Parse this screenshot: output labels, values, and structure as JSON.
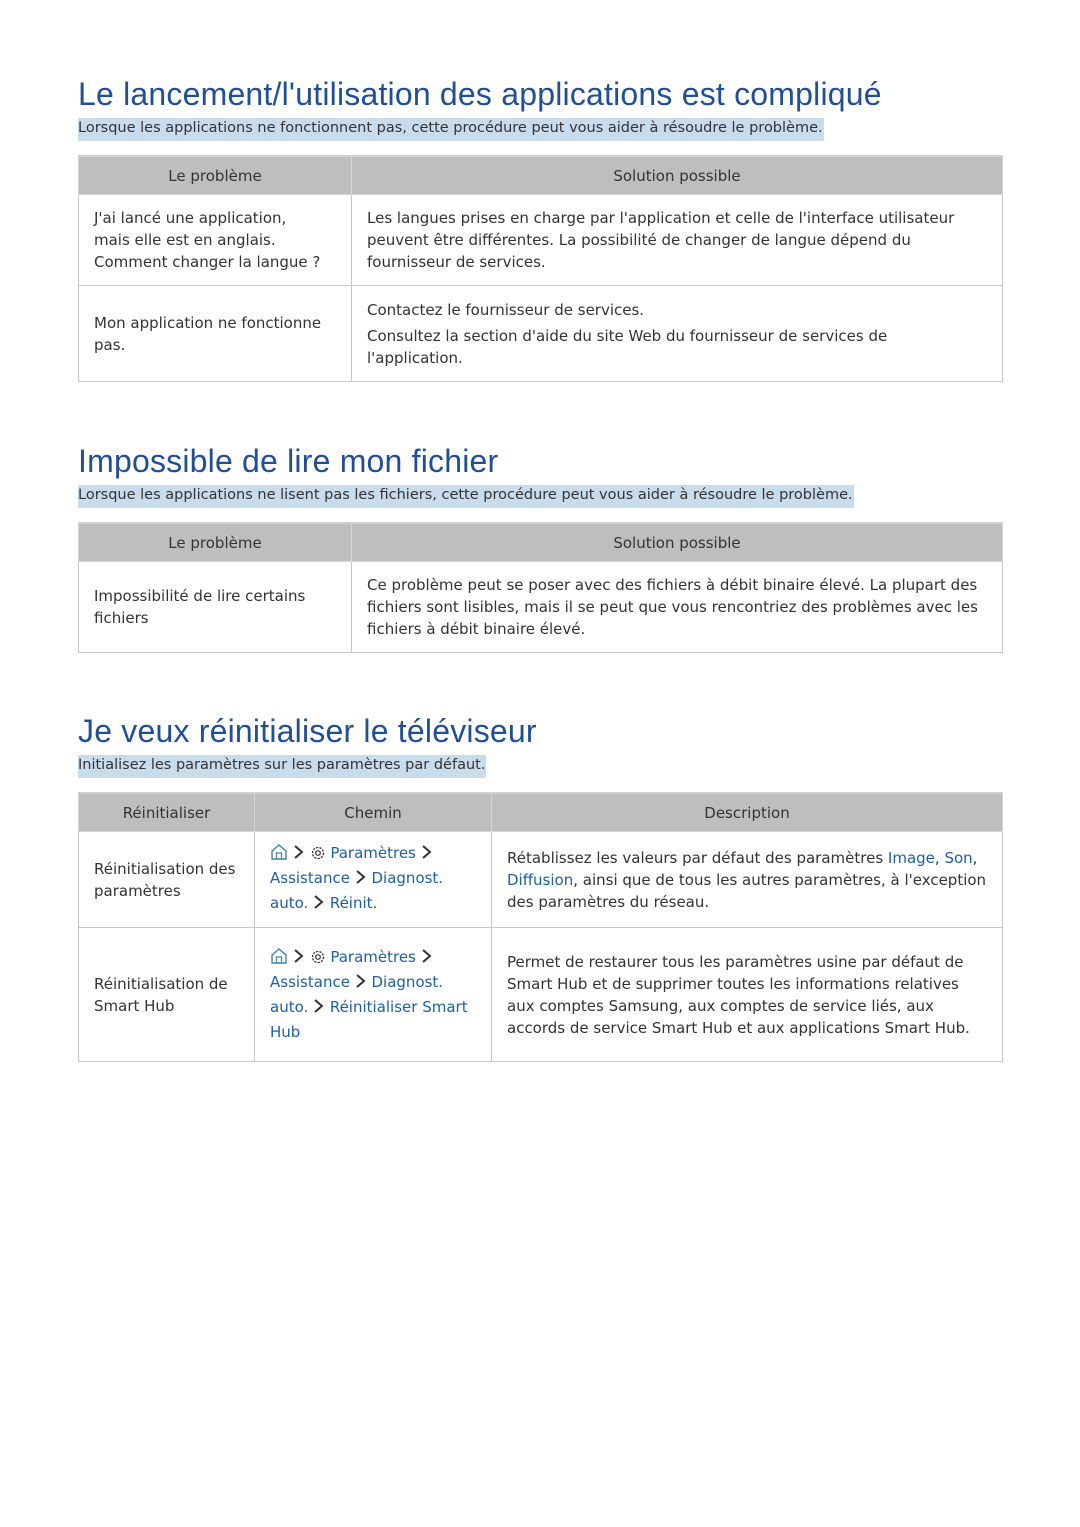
{
  "sections": [
    {
      "title": "Le lancement/l'utilisation des applications est compliqué",
      "intro": "Lorsque les applications ne fonctionnent pas, cette procédure peut vous aider à résoudre le problème.",
      "headers": [
        "Le problème",
        "Solution possible"
      ],
      "rows": [
        {
          "problem": [
            "J'ai lancé une application,",
            "mais elle est en anglais.",
            "Comment changer la langue ?"
          ],
          "solution": [
            "Les langues prises en charge par l'application et celle de l'interface utilisateur peuvent être différentes. La possibilité de changer de langue dépend du fournisseur de services."
          ]
        },
        {
          "problem": [
            "Mon application ne fonctionne pas."
          ],
          "solution": [
            "Contactez le fournisseur de services.",
            "Consultez la section d'aide du site Web du fournisseur de services de l'application."
          ]
        }
      ]
    },
    {
      "title": "Impossible de lire mon fichier",
      "intro": "Lorsque les applications ne lisent pas les fichiers, cette procédure peut vous aider à résoudre le problème.",
      "headers": [
        "Le problème",
        "Solution possible"
      ],
      "rows": [
        {
          "problem": [
            "Impossibilité de lire certains fichiers"
          ],
          "solution": [
            "Ce problème peut se poser avec des fichiers à débit binaire élevé. La plupart des fichiers sont lisibles, mais il se peut que vous rencontriez des problèmes avec les fichiers à débit binaire élevé."
          ]
        }
      ]
    },
    {
      "title": "Je veux réinitialiser le téléviseur",
      "intro": "Initialisez les paramètres sur les paramètres par défaut.",
      "headers": [
        "Réinitialiser",
        "Chemin",
        "Description"
      ],
      "rows": [
        {
          "reset": "Réinitialisation des paramètres",
          "path": {
            "home_icon": "home-icon",
            "settings_icon": "gear-icon",
            "settings": "Paramètres",
            "steps": [
              "Assistance",
              "Diagnost. auto.",
              "Réinit."
            ]
          },
          "description": {
            "before": "Rétablissez les valeurs par défaut des paramètres ",
            "link1": "Image",
            "sep1": ", ",
            "link2": "Son",
            "sep2": ", ",
            "link3": "Diffusion",
            "after": ", ainsi que de tous les autres paramètres, à l'exception des paramètres du réseau."
          }
        },
        {
          "reset": "Réinitialisation de Smart Hub",
          "path": {
            "home_icon": "home-icon",
            "settings_icon": "gear-icon",
            "settings": "Paramètres",
            "steps": [
              "Assistance",
              "Diagnost. auto.",
              "Réinitialiser Smart Hub"
            ]
          },
          "description": {
            "text": "Permet de restaurer tous les paramètres usine par défaut de Smart Hub et de supprimer toutes les informations relatives aux comptes Samsung, aux comptes de service liés, aux accords de service Smart Hub et aux applications Smart Hub."
          }
        }
      ]
    }
  ],
  "colors": {
    "heading": "#1f4e9c",
    "highlight": "#c8dcec",
    "table_header": "#bcbec0",
    "link": "#1b5fae"
  }
}
